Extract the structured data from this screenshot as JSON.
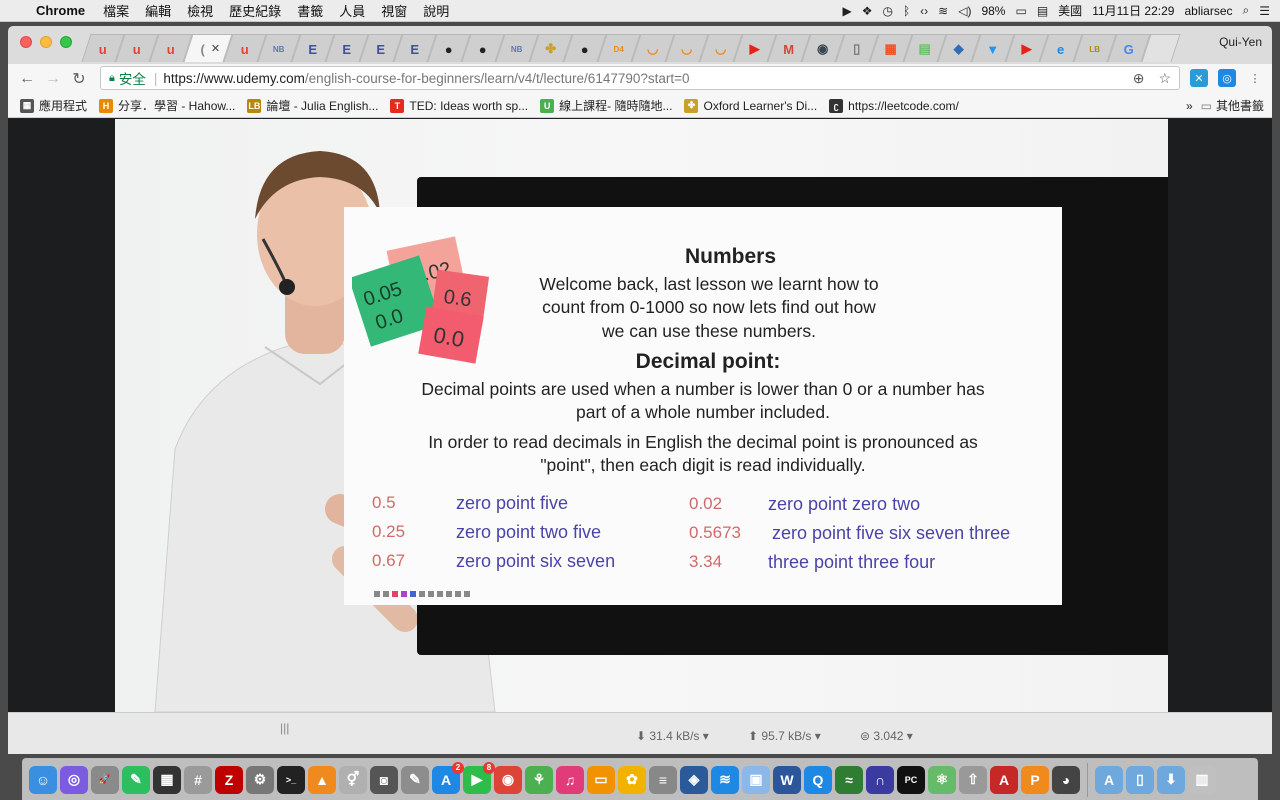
{
  "menubar": {
    "app_name": "Chrome",
    "menus": [
      "檔案",
      "編輯",
      "檢視",
      "歷史紀錄",
      "書籤",
      "人員",
      "視窗",
      "說明"
    ],
    "battery": "98%",
    "input_source": "美國",
    "clock": "11月11日  22:29",
    "user": "abliarsec"
  },
  "window": {
    "profile_name": "Qui-Yen",
    "tabs": [
      {
        "icon": "udemy-icon",
        "glyph": "u",
        "color": "#e0453a"
      },
      {
        "icon": "udemy-icon",
        "glyph": "u",
        "color": "#e0453a"
      },
      {
        "icon": "udemy-icon",
        "glyph": "u",
        "color": "#e0453a"
      },
      {
        "icon": "loading-icon",
        "glyph": "(",
        "color": "#888888",
        "active": true
      },
      {
        "icon": "udemy-icon",
        "glyph": "u",
        "color": "#e0453a"
      },
      {
        "icon": "nb-icon",
        "glyph": "NB",
        "color": "#5a7bb5"
      },
      {
        "icon": "e-icon",
        "glyph": "E",
        "color": "#3d4fa3"
      },
      {
        "icon": "e-icon",
        "glyph": "E",
        "color": "#3d4fa3"
      },
      {
        "icon": "e-icon",
        "glyph": "E",
        "color": "#3d4fa3"
      },
      {
        "icon": "e-icon",
        "glyph": "E",
        "color": "#3d4fa3"
      },
      {
        "icon": "github-icon",
        "glyph": "●",
        "color": "#222222"
      },
      {
        "icon": "github-icon",
        "glyph": "●",
        "color": "#222222"
      },
      {
        "icon": "nb-icon",
        "glyph": "NB",
        "color": "#5a7bb5"
      },
      {
        "icon": "oxford-icon",
        "glyph": "✤",
        "color": "#c9a02a"
      },
      {
        "icon": "github-icon",
        "glyph": "●",
        "color": "#222222"
      },
      {
        "icon": "d4-icon",
        "glyph": "D4",
        "color": "#f08a1c"
      },
      {
        "icon": "loading-icon",
        "glyph": "◡",
        "color": "#f08a1c"
      },
      {
        "icon": "loading-icon",
        "glyph": "◡",
        "color": "#f08a1c"
      },
      {
        "icon": "loading-icon",
        "glyph": "◡",
        "color": "#f08a1c"
      },
      {
        "icon": "youtube-icon",
        "glyph": "▶",
        "color": "#e62117"
      },
      {
        "icon": "gmail-icon",
        "glyph": "M",
        "color": "#d44638"
      },
      {
        "icon": "circle-icon",
        "glyph": "◉",
        "color": "#37474f"
      },
      {
        "icon": "document-icon",
        "glyph": "▯",
        "color": "#777777"
      },
      {
        "icon": "microsoft-icon",
        "glyph": "▦",
        "color": "#f25022"
      },
      {
        "icon": "sheet-icon",
        "glyph": "▤",
        "color": "#6abf69"
      },
      {
        "icon": "stack-icon",
        "glyph": "◆",
        "color": "#2f6eb5"
      },
      {
        "icon": "funnel-icon",
        "glyph": "▼",
        "color": "#2196f3"
      },
      {
        "icon": "youtube-icon",
        "glyph": "▶",
        "color": "#e62117"
      },
      {
        "icon": "edge-icon",
        "glyph": "e",
        "color": "#1e88e5"
      },
      {
        "icon": "lb-icon",
        "glyph": "LB",
        "color": "#b8860b"
      },
      {
        "icon": "google-icon",
        "glyph": "G",
        "color": "#4285f4"
      }
    ]
  },
  "toolbar": {
    "secure_label": "安全",
    "url_host": "https://www.udemy.com",
    "url_path": "/english-course-for-beginners/learn/v4/t/lecture/6147790?start=0"
  },
  "bookmarks": {
    "items": [
      {
        "label": "應用程式",
        "icon": "apps-grid-icon",
        "color": "#555555",
        "glyph": "▦"
      },
      {
        "label": "分享．學習 - Hahow...",
        "icon": "hahow-icon",
        "color": "#e88a00",
        "glyph": "H"
      },
      {
        "label": "論壇 - Julia English...",
        "icon": "lb-icon",
        "color": "#b8860b",
        "glyph": "LB"
      },
      {
        "label": "TED: Ideas worth sp...",
        "icon": "ted-icon",
        "color": "#e62b1e",
        "glyph": "T"
      },
      {
        "label": "線上課程- 隨時隨地...",
        "icon": "udemy-icon",
        "color": "#4caf50",
        "glyph": "U"
      },
      {
        "label": "Oxford Learner's Di...",
        "icon": "oxford-icon",
        "color": "#c9a02a",
        "glyph": "✤"
      },
      {
        "label": "https://leetcode.com/",
        "icon": "leetcode-icon",
        "color": "#333333",
        "glyph": "ʗ"
      }
    ],
    "overflow": "»",
    "other_folder": "其他書籤"
  },
  "slide": {
    "title": "Numbers",
    "intro": [
      "Welcome back, last lesson we learnt how to",
      "count from 0-1000 so now lets find out how",
      "we can use these numbers."
    ],
    "cards": [
      "0.05",
      "0.02",
      "0.0",
      "0.6",
      "0.0"
    ],
    "decimal_title": "Decimal point:",
    "para1": [
      "Decimal points are used when a number is lower than 0 or a number has",
      "part of a whole number included."
    ],
    "para2": [
      "In order to read decimals in English the decimal point is pronounced as",
      "\"point\", then each digit is read individually."
    ],
    "examples_left": [
      {
        "num": "0.5",
        "words": "zero point five"
      },
      {
        "num": "0.25",
        "words": "zero point two five"
      },
      {
        "num": "0.67",
        "words": "zero point six seven"
      }
    ],
    "examples_right": [
      {
        "num": "0.02",
        "words": "zero point zero two"
      },
      {
        "num": "0.5673",
        "words": "zero point five six seven three"
      },
      {
        "num": "3.34",
        "words": "three point three four"
      }
    ]
  },
  "status": {
    "download": "⬇ 31.4 kB/s ▾",
    "upload": "⬆ 95.7 kB/s ▾",
    "ratio": "⊜ 3.042 ▾"
  },
  "dock": {
    "apps": [
      {
        "icon": "finder-icon",
        "color": "#3b8fe0",
        "glyph": "☺"
      },
      {
        "icon": "siri-icon",
        "color": "#7b5ce0",
        "glyph": "◎"
      },
      {
        "icon": "launchpad-icon",
        "color": "#8a8a8a",
        "glyph": "🚀"
      },
      {
        "icon": "evernote-icon",
        "color": "#2dbe60",
        "glyph": "✎"
      },
      {
        "icon": "monitor-icon",
        "color": "#333333",
        "glyph": "▦"
      },
      {
        "icon": "script-editor-icon",
        "color": "#9a9a9a",
        "glyph": "#"
      },
      {
        "icon": "filezilla-icon",
        "color": "#bf0000",
        "glyph": "Z"
      },
      {
        "icon": "preferences-icon",
        "color": "#777777",
        "glyph": "⚙"
      },
      {
        "icon": "terminal-icon",
        "color": "#222222",
        "glyph": ">_"
      },
      {
        "icon": "vlc-icon",
        "color": "#f08a1c",
        "glyph": "▲"
      },
      {
        "icon": "gender-icon",
        "color": "#b0b0b0",
        "glyph": "⚥"
      },
      {
        "icon": "camera-icon",
        "color": "#555555",
        "glyph": "◙"
      },
      {
        "icon": "pencil-icon",
        "color": "#8d8d8d",
        "glyph": "✎"
      },
      {
        "icon": "appstore-icon",
        "color": "#1e88e5",
        "glyph": "A",
        "badge": "2"
      },
      {
        "icon": "facetime-icon",
        "color": "#2ebd4a",
        "glyph": "▶",
        "badge": "8"
      },
      {
        "icon": "chrome-icon",
        "color": "#db4437",
        "glyph": "◉"
      },
      {
        "icon": "sourcetree-icon",
        "color": "#4caf50",
        "glyph": "⚘"
      },
      {
        "icon": "itunes-icon",
        "color": "#e23b7a",
        "glyph": "♫"
      },
      {
        "icon": "books-icon",
        "color": "#f29200",
        "glyph": "▭"
      },
      {
        "icon": "photos-icon",
        "color": "#f2b200",
        "glyph": "✿"
      },
      {
        "icon": "database-icon",
        "color": "#888888",
        "glyph": "≡"
      },
      {
        "icon": "virtualbox-icon",
        "color": "#2a5a9a",
        "glyph": "◈"
      },
      {
        "icon": "wifi-icon",
        "color": "#1e88e5",
        "glyph": "≋"
      },
      {
        "icon": "preview-icon",
        "color": "#8bb8e8",
        "glyph": "▣"
      },
      {
        "icon": "word-icon",
        "color": "#2b579a",
        "glyph": "W"
      },
      {
        "icon": "qq-icon",
        "color": "#1e88e5",
        "glyph": "Q"
      },
      {
        "icon": "activity-monitor-icon",
        "color": "#2e7d32",
        "glyph": "≈"
      },
      {
        "icon": "headphones-icon",
        "color": "#3a3aa0",
        "glyph": "∩"
      },
      {
        "icon": "pycharm-icon",
        "color": "#111111",
        "glyph": "PC"
      },
      {
        "icon": "atom-icon",
        "color": "#66bb6a",
        "glyph": "⚛"
      },
      {
        "icon": "rocket-icon",
        "color": "#999999",
        "glyph": "⇧"
      },
      {
        "icon": "acrobat-icon",
        "color": "#c62828",
        "glyph": "A"
      },
      {
        "icon": "slides-icon",
        "color": "#f08a1c",
        "glyph": "P"
      },
      {
        "icon": "panda-icon",
        "color": "#444444",
        "glyph": "◕"
      },
      {
        "icon": "applications-folder-icon",
        "color": "#6fa8dc",
        "glyph": "A"
      },
      {
        "icon": "documents-folder-icon",
        "color": "#6fa8dc",
        "glyph": "▯"
      },
      {
        "icon": "downloads-folder-icon",
        "color": "#6fa8dc",
        "glyph": "⬇"
      },
      {
        "icon": "trash-icon",
        "color": "#c0c0c0",
        "glyph": "▥"
      }
    ]
  }
}
